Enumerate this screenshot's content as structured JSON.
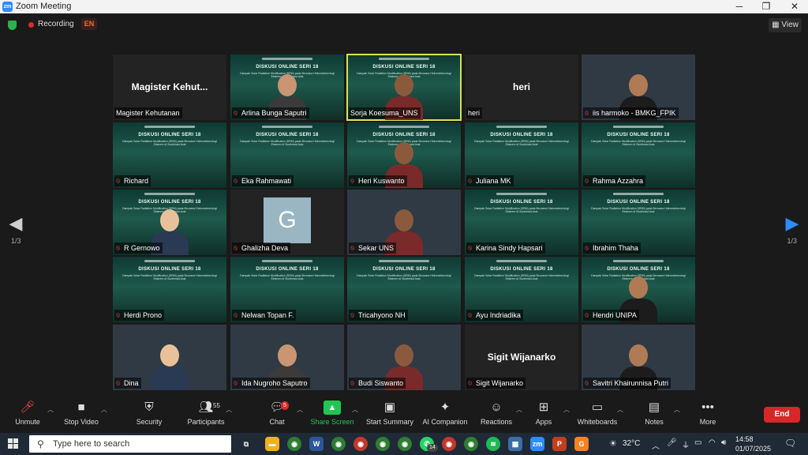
{
  "window": {
    "title": "Zoom Meeting",
    "minimize": "─",
    "maximize": "❐",
    "close": "✕"
  },
  "status": {
    "recording": "Recording",
    "language": "EN",
    "view": "View"
  },
  "paging": {
    "left": "1/3",
    "right": "1/3"
  },
  "slide": {
    "title": "DISKUSI ONLINE SERI 18",
    "subtitle": "Dampak Solar Radiation Modification (SRM) pada Bencana Hidrometeorologi Ekstrem di Southeast Asia"
  },
  "tiles": [
    {
      "name": "Magister Kehutanan",
      "big": "Magister  Kehut..."
    },
    {
      "name": "Arlina Bunga Saputri"
    },
    {
      "name": "Sorja Koesuma_UNS"
    },
    {
      "name": "heri",
      "big": "heri"
    },
    {
      "name": "iis harmoko - BMKG_FPIK"
    },
    {
      "name": "Richard"
    },
    {
      "name": "Eka Rahmawati"
    },
    {
      "name": "Heri Kuswanto"
    },
    {
      "name": "Juliana MK"
    },
    {
      "name": "Rahma Azzahra"
    },
    {
      "name": "R Gernowo"
    },
    {
      "name": "Ghalizha Deva",
      "initial": "G"
    },
    {
      "name": "Sekar UNS"
    },
    {
      "name": "Karina Sindy Hapsari"
    },
    {
      "name": "Ibrahim Thaha"
    },
    {
      "name": "Herdi Prono"
    },
    {
      "name": "Nelwan Topan F."
    },
    {
      "name": "Tricahyono NH"
    },
    {
      "name": "Ayu Indriadika"
    },
    {
      "name": "Hendri UNIPA"
    },
    {
      "name": "Dina"
    },
    {
      "name": "Ida Nugroho Saputro"
    },
    {
      "name": "Budi Siswanto"
    },
    {
      "name": "Sigit Wijanarko",
      "big": "Sigit Wijanarko"
    },
    {
      "name": "Savitri Khairunnisa Putri"
    }
  ],
  "toolbar": {
    "unmute": "Unmute",
    "stop_video": "Stop Video",
    "security": "Security",
    "participants": "Participants",
    "participants_count": "55",
    "chat": "Chat",
    "chat_badge": "5",
    "share_screen": "Share Screen",
    "start_summary": "Start Summary",
    "ai_companion": "AI Companion",
    "reactions": "Reactions",
    "apps": "Apps",
    "whiteboards": "Whiteboards",
    "notes": "Notes",
    "more": "More",
    "end": "End"
  },
  "taskbar": {
    "search_placeholder": "Type here to search",
    "temperature": "32°C",
    "time": "14:58",
    "date": "01/07/2025",
    "whatsapp_badge": "14"
  },
  "colors": {
    "accent": "#2d8cff",
    "end": "#d62828",
    "active_speaker": "#d5e54f",
    "share": "#23c552"
  }
}
